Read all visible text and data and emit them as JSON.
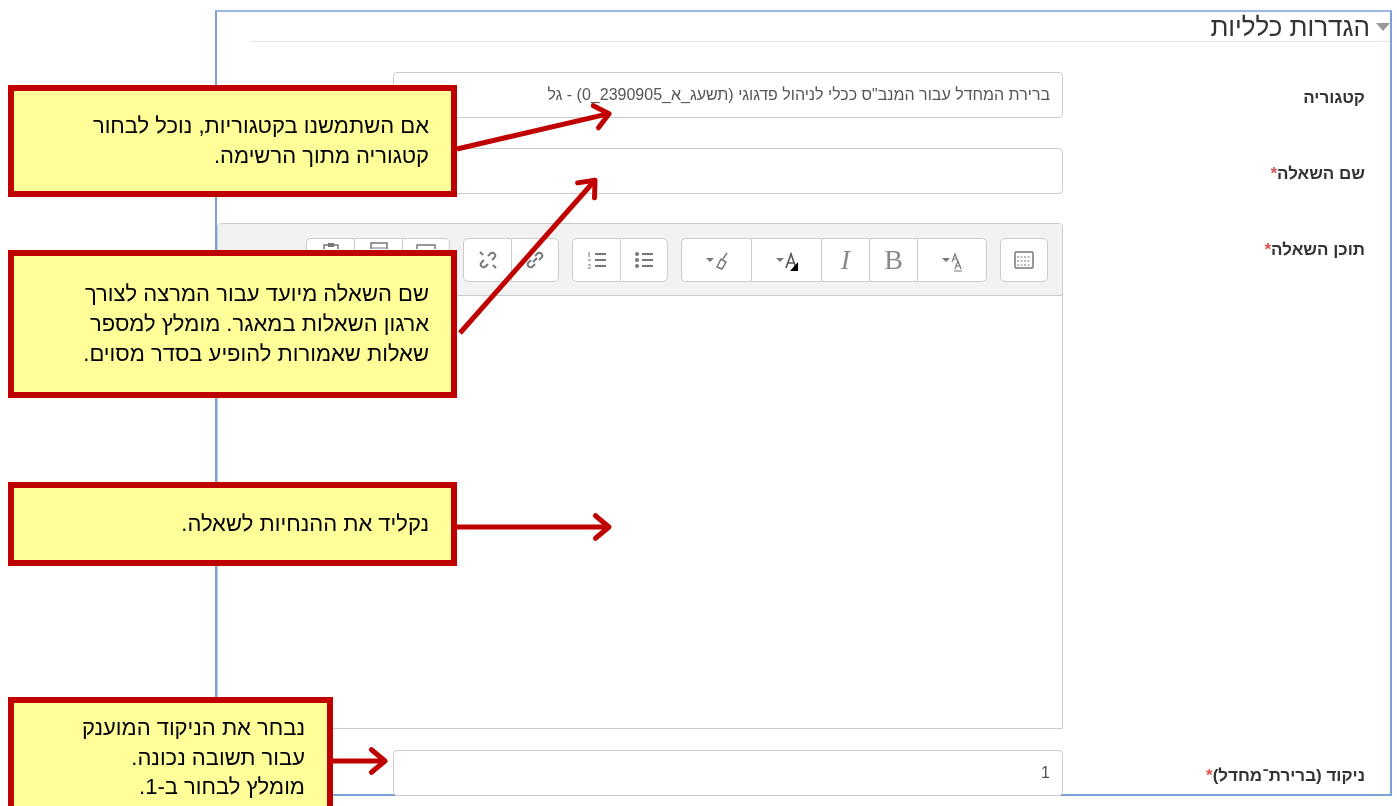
{
  "section": {
    "title": "הגדרות כלליות",
    "expanded": true
  },
  "fields": [
    {
      "kind": "select",
      "label": "קטגוריה",
      "value": "ברירת המחדל עבור המנב\"ס ככלי לניהול פדגוגי (תשעג_א_2390905_0) - גל"
    },
    {
      "kind": "text",
      "label": "שם השאלה",
      "required_mark": "*"
    },
    {
      "kind": "editor",
      "label": "תוכן השאלה",
      "required_mark": "*",
      "toolbar_groups": [
        [
          {
            "kind": "toggle"
          }
        ],
        [
          {
            "kind": "font-size"
          },
          {
            "kind": "bold",
            "label": "B"
          },
          {
            "kind": "italic",
            "label": "I"
          },
          {
            "kind": "text-color"
          },
          {
            "kind": "highlight"
          }
        ],
        [
          {
            "kind": "bullet-list"
          },
          {
            "kind": "numbered-list"
          }
        ],
        [
          {
            "kind": "link"
          },
          {
            "kind": "unlink"
          }
        ],
        [
          {
            "kind": "picture"
          },
          {
            "kind": "film"
          },
          {
            "kind": "clipboard"
          }
        ]
      ]
    },
    {
      "kind": "text",
      "label": "ניקוד (ברירת־מחדל)",
      "required_mark": "*",
      "value": "1"
    }
  ],
  "callouts": [
    {
      "text": "אם השתמשנו בקטגוריות, נוכל לבחור\nקטגוריה מתוך הרשימה."
    },
    {
      "text": "שם השאלה מיועד עבור המרצה לצורך\nארגון השאלות במאגר. מומלץ למספר\nשאלות שאמורות להופיע בסדר מסוים."
    },
    {
      "text": "נקליד את ההנחיות לשאלה."
    },
    {
      "text": "נבחר את הניקוד המוענק\nעבור תשובה נכונה.\nמומלץ לבחור ב-1."
    }
  ]
}
